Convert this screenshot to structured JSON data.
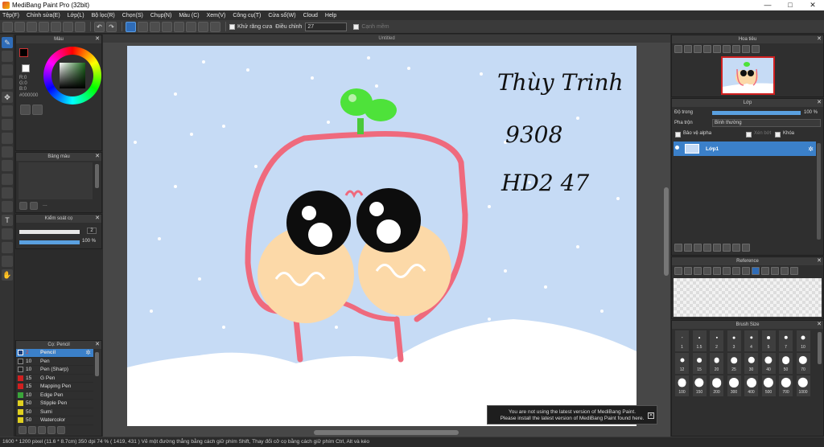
{
  "window": {
    "title": "MediBang Paint Pro (32bit)",
    "minimize": "—",
    "maximize": "□",
    "close": "✕"
  },
  "menu": [
    "Tệp(F)",
    "Chỉnh sửa(E)",
    "Lớp(L)",
    "Bộ lọc(R)",
    "Chọn(S)",
    "Chụp(N)",
    "Màu (C)",
    "Xem(V)",
    "Công cụ(T)",
    "Cửa sổ(W)",
    "Cloud",
    "Help"
  ],
  "toolbar": {
    "antialias_label": "Khử răng cưa",
    "adjust_label": "Điều chỉnh",
    "adjust_value": "27",
    "smooth_label": "Cạnh mềm"
  },
  "color_panel": {
    "title": "Màu",
    "r": "R:0",
    "g": "G:0",
    "b": "B:0",
    "hex": "#000000"
  },
  "palette_panel": {
    "title": "Bảng màu",
    "more": "..."
  },
  "brush_control": {
    "title": "Kiểm soát cọ",
    "size": "2",
    "opacity": "100 %"
  },
  "brush_panel": {
    "title": "Cọ: Pencil",
    "brushes": [
      {
        "size": "2",
        "name": "Pencil",
        "color": "#1a3d7c"
      },
      {
        "size": "10",
        "name": "Pen",
        "color": "#222222"
      },
      {
        "size": "10",
        "name": "Pen (Sharp)",
        "color": "#222222"
      },
      {
        "size": "15",
        "name": "G Pen",
        "color": "#d02020"
      },
      {
        "size": "15",
        "name": "Mapping Pen",
        "color": "#d02020"
      },
      {
        "size": "10",
        "name": "Edge Pen",
        "color": "#3aa53a"
      },
      {
        "size": "50",
        "name": "Stipple Pen",
        "color": "#e0d020"
      },
      {
        "size": "50",
        "name": "Sumi",
        "color": "#e0d020"
      },
      {
        "size": "50",
        "name": "Watercolor",
        "color": "#e0d020"
      }
    ]
  },
  "canvas": {
    "tab_title": "Untitled",
    "handwriting": [
      "Thùy Trinh",
      "9308",
      "HD2 47"
    ]
  },
  "toast": {
    "line1": "You are not using the latest version of MediBang Paint.",
    "line2": "Please install the latest version of MediBang Paint found here."
  },
  "navigator": {
    "title": "Hoa tiêu"
  },
  "layer_panel": {
    "title": "Lớp",
    "opacity_label": "Độ trong",
    "opacity_value": "100 %",
    "blend_label": "Pha trộn",
    "blend_value": "Bình thường",
    "protect_alpha": "Bảo vệ alpha",
    "clipping": "Xén bớt",
    "lock": "Khóa",
    "layer_name": "Lớp1"
  },
  "reference": {
    "title": "Reference"
  },
  "brush_size": {
    "title": "Brush Size",
    "sizes": [
      "1",
      "1.5",
      "2",
      "3",
      "4",
      "5",
      "7",
      "10",
      "12",
      "15",
      "20",
      "25",
      "30",
      "40",
      "50",
      "70",
      "100",
      "150",
      "200",
      "300",
      "400",
      "500",
      "700",
      "1000"
    ]
  },
  "status": "1600 * 1200 pixel   (11.6 * 8.7cm)   350 dpi   74 %   ( 1419, 431 )   Vẽ một đường thẳng bằng cách giữ phím Shift, Thay đổi cỡ cọ bằng cách giữ phím Ctrl, Alt và kéo"
}
